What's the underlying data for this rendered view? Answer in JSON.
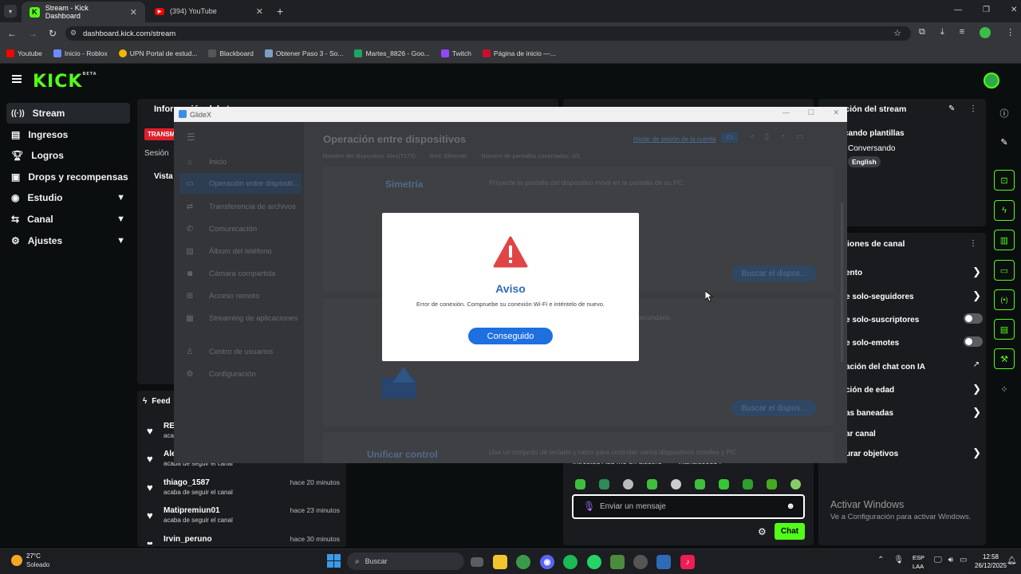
{
  "browser": {
    "tabs": [
      {
        "title": "Stream - Kick Dashboard",
        "icon": "kick-icon"
      },
      {
        "title": "(394) YouTube",
        "icon": "youtube-icon"
      }
    ],
    "url": "dashboard.kick.com/stream",
    "bookmarks": [
      {
        "label": "Youtube",
        "color": "#ff0000"
      },
      {
        "label": "Inicio - Roblox",
        "color": "#6a8cff"
      },
      {
        "label": "UPN Portal de estud...",
        "color": "#f2b600"
      },
      {
        "label": "Blackboard",
        "color": "#333333"
      },
      {
        "label": "Obtener Paso 3 - So...",
        "color": "#7aa0c4"
      },
      {
        "label": "Martes_8826 - Goo...",
        "color": "#1fa463"
      },
      {
        "label": "Twitch",
        "color": "#9146ff"
      },
      {
        "label": "Página de inicio —...",
        "color": "#c8102e"
      }
    ]
  },
  "kick": {
    "logo": "KICK",
    "logo_sup": "BETA",
    "nav": [
      {
        "label": "Stream",
        "icon": "stream-icon",
        "chevron": false,
        "selected": true
      },
      {
        "label": "Ingresos",
        "icon": "list-icon",
        "chevron": false
      },
      {
        "label": "Logros",
        "icon": "trophy-icon",
        "chevron": false
      },
      {
        "label": "Drops y recompensas",
        "icon": "gift-icon",
        "chevron": false
      },
      {
        "label": "Estudio",
        "icon": "studio-icon",
        "chevron": true
      },
      {
        "label": "Canal",
        "icon": "channel-icon",
        "chevron": true
      },
      {
        "label": "Ajustes",
        "icon": "gear-icon",
        "chevron": true
      }
    ],
    "info_panel_title": "Información del stream",
    "transmit_badge": "TRANSM",
    "session_label": "Sesión",
    "vista_label": "Vista",
    "feed_title": "Feed",
    "feed": [
      {
        "name": "REA",
        "sub": "acab",
        "time": ""
      },
      {
        "name": "Ale",
        "sub": "acaba de seguir el canal",
        "time": ""
      },
      {
        "name": "thiago_1587",
        "sub": "acaba de seguir el canal",
        "time": "hace 20 minutos"
      },
      {
        "name": "Matipremiun01",
        "sub": "acaba de seguir el canal",
        "time": "hace 23 minutos"
      },
      {
        "name": "Irvin_peruno",
        "sub": "",
        "time": "hace 30 minutos"
      }
    ],
    "right_info_title": "rmación del stream",
    "right_info_lines": [
      "cando plantillas",
      "Conversando"
    ],
    "right_info_tag": "English",
    "channel_options_title": "iones de canal",
    "channel_options": [
      {
        "label": "ento",
        "control": "arrow"
      },
      {
        "label": "e solo-seguidores",
        "control": "arrow"
      },
      {
        "label": "e solo-suscriptores",
        "control": "toggle"
      },
      {
        "label": "e solo-emotes",
        "control": "toggle"
      },
      {
        "label": "ación del chat con IA",
        "control": "external"
      },
      {
        "label": "ción de edad",
        "control": "arrow"
      },
      {
        "label": "as baneadas",
        "control": "arrow"
      },
      {
        "label": "ar canal",
        "control": "none"
      },
      {
        "label": "urar objetivos",
        "control": "arrow"
      }
    ],
    "chat_tail": "intrested Add me on discord >>> mandiceo854",
    "chat_placeholder": "Enviar un mensaje",
    "chat_button": "Chat",
    "activate_windows_title": "Activar Windows",
    "activate_windows_sub": "Ve a Configuración para activar Windows."
  },
  "glidex": {
    "window_title": "GlideX",
    "nav": [
      {
        "label": "Inicio",
        "icon": "home-icon"
      },
      {
        "label": "Operación entre dispositi...",
        "icon": "devices-icon",
        "selected": true
      },
      {
        "label": "Transferencia de archivos",
        "icon": "transfer-icon"
      },
      {
        "label": "Comunicación",
        "icon": "phone-icon"
      },
      {
        "label": "Álbum del teléfono",
        "icon": "album-icon"
      },
      {
        "label": "Cámara compartida",
        "icon": "camera-icon"
      },
      {
        "label": "Acceso remoto",
        "icon": "remote-icon"
      },
      {
        "label": "Streaming de aplicaciones",
        "icon": "apps-icon"
      },
      {
        "label": "Centro de usuarios",
        "icon": "user-icon"
      },
      {
        "label": "Configuración",
        "icon": "settings-icon"
      }
    ],
    "heading": "Operación entre dispositivos",
    "login_link": "Iniciar de sesión de la cuenta",
    "device_name": "Nombre del dispositivo: Alex(7175)",
    "connection": "Red: Ethernet",
    "screens": "Número de pantallas conectadas: 0/1",
    "sections": [
      {
        "title": "Simetría",
        "desc": "Proyecte la pantalla del dispositivo móvil en la pantalla de su PC.",
        "button": "Buscar el dispos..."
      },
      {
        "title": "",
        "desc": "a secundaria.",
        "button": "Buscar el dispos..."
      },
      {
        "title": "Unificar control",
        "desc": "Use un conjunto de teclado y ratón para controlar varios dispositivos móviles y PC.",
        "button": ""
      }
    ]
  },
  "dialog": {
    "icon": "warning-icon",
    "title": "Aviso",
    "message": "Error de conexión. Compruebe su conexión Wi-Fi e inténtelo de nuevo.",
    "button": "Conseguido"
  },
  "taskbar": {
    "weather_temp": "27°C",
    "weather_desc": "Soleado",
    "search_placeholder": "Buscar",
    "lang": "ESP",
    "lang2": "LAA",
    "time": "12:58",
    "date": "26/12/2025"
  }
}
